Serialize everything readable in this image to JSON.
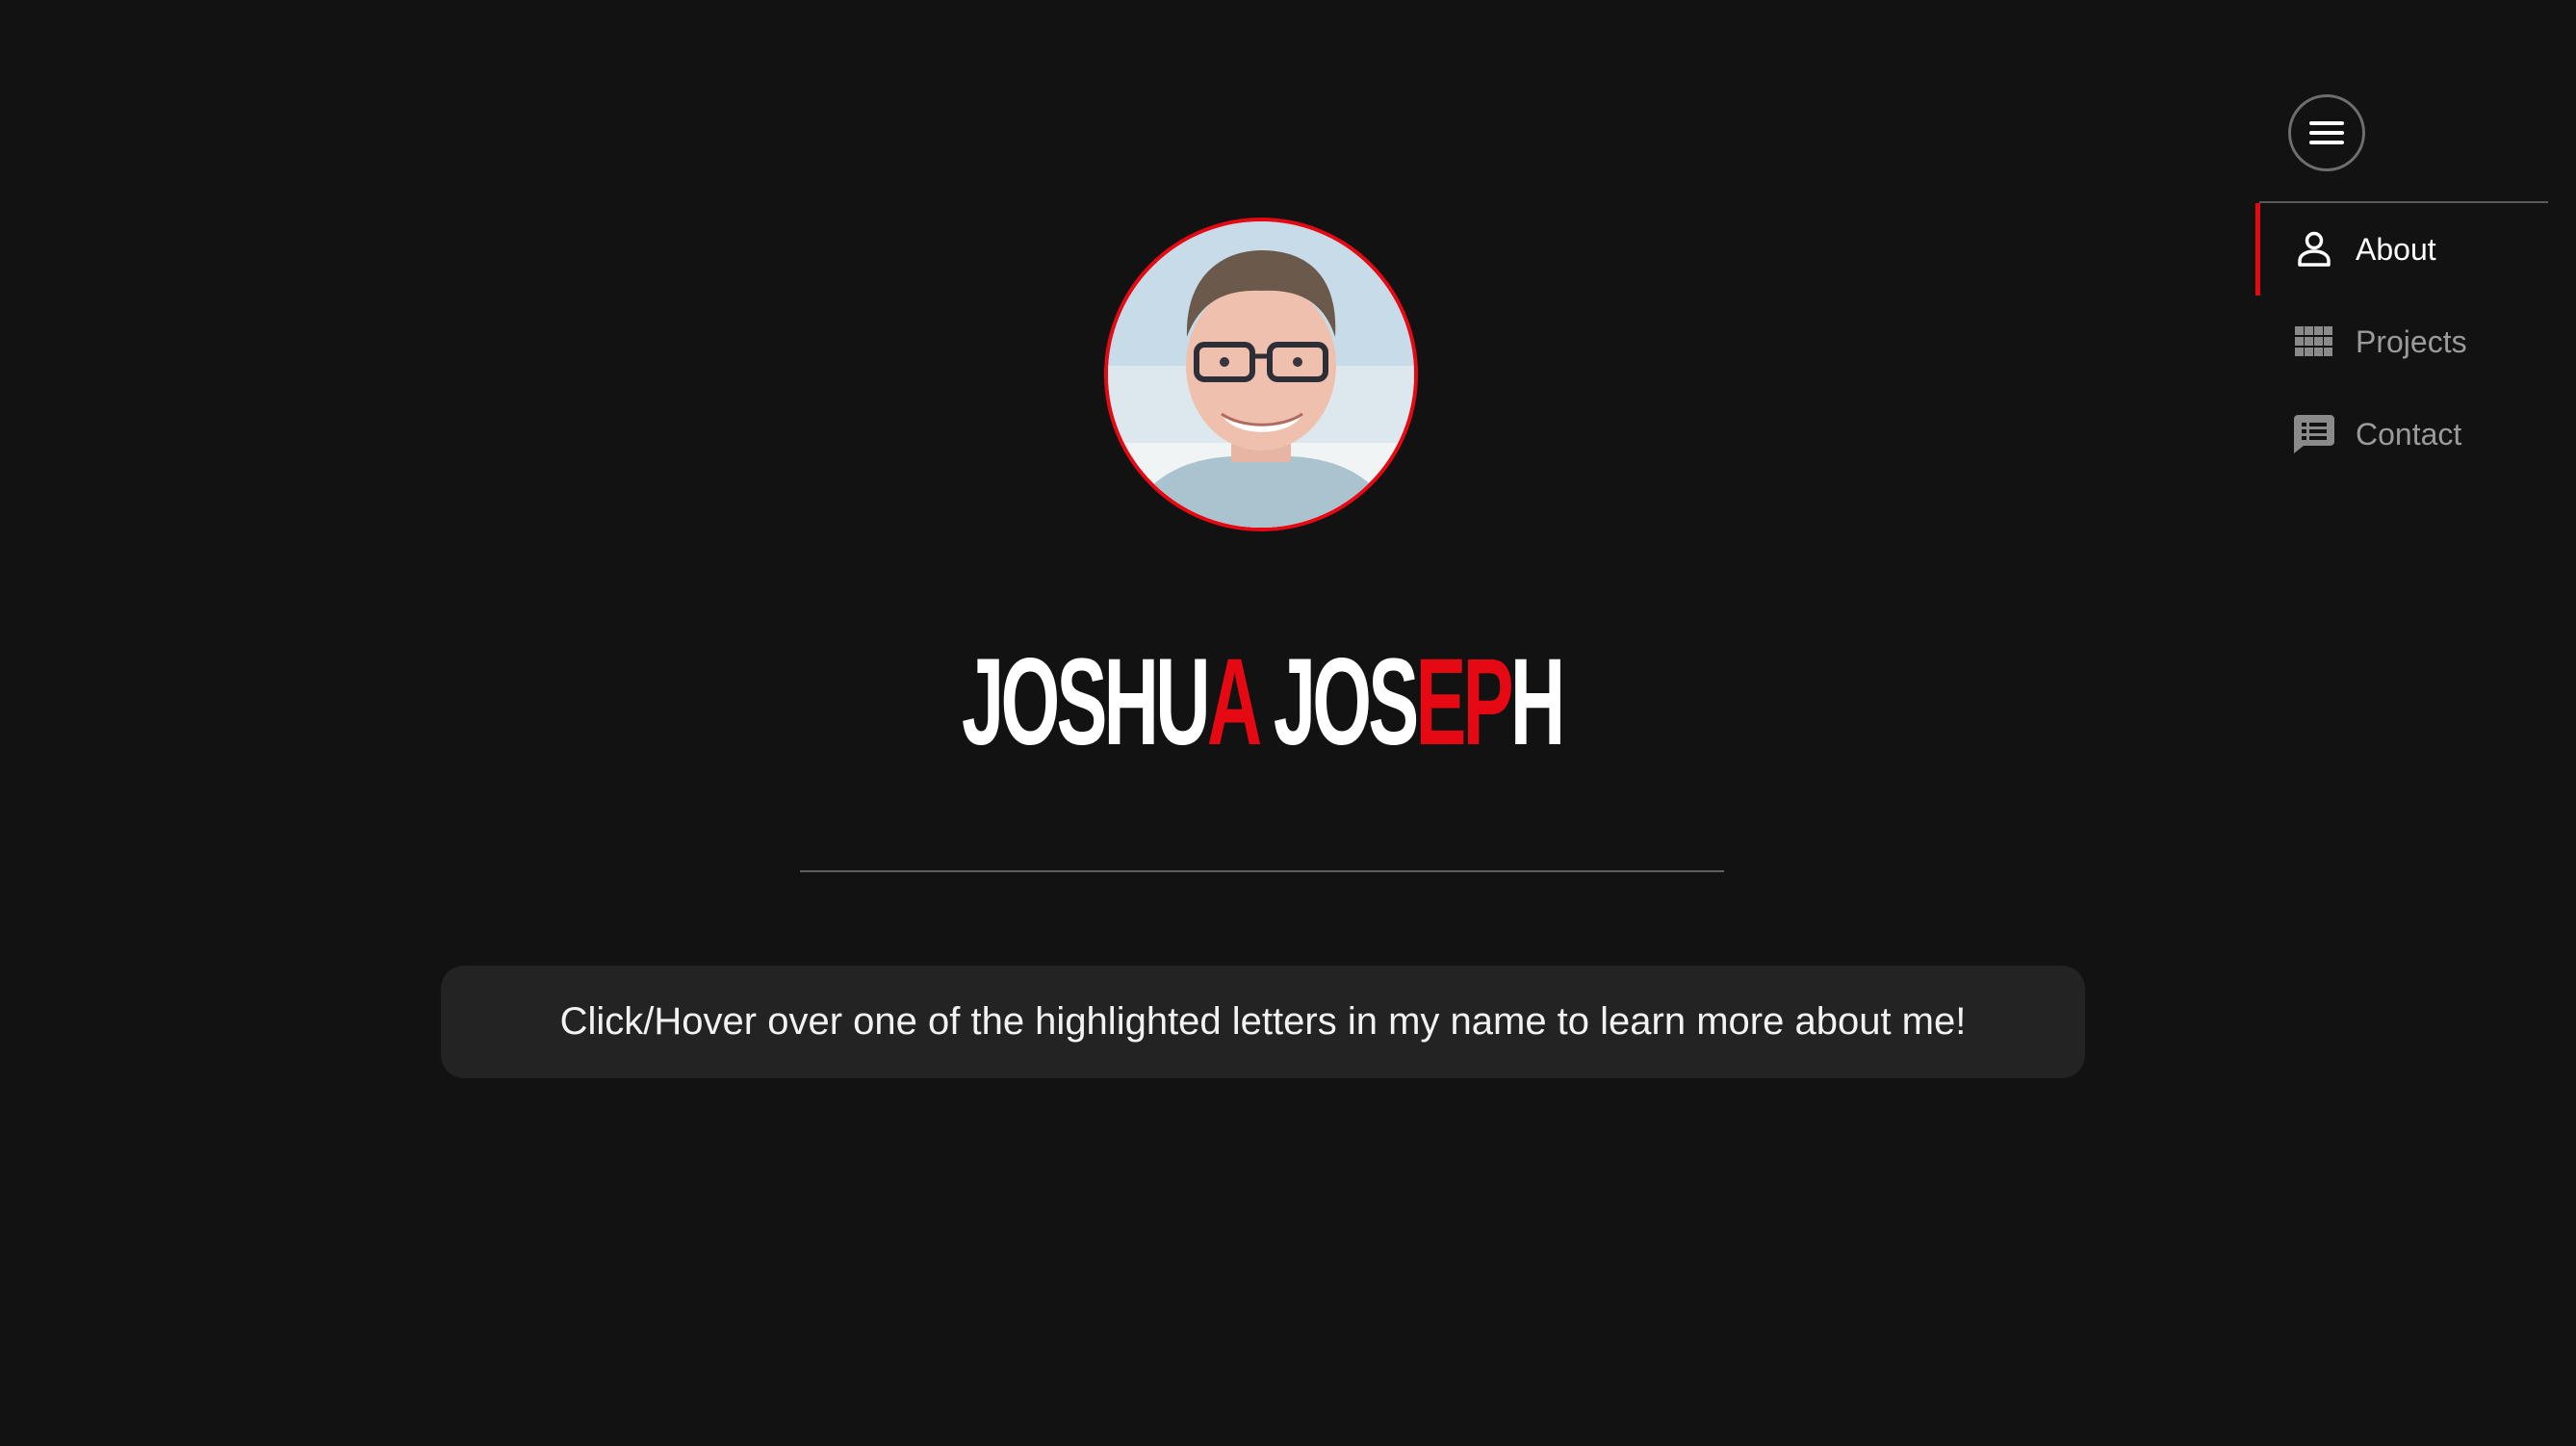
{
  "nav": {
    "menu_icon": "hamburger-menu-icon",
    "items": [
      {
        "label": "About",
        "icon": "person-icon",
        "active": true
      },
      {
        "label": "Projects",
        "icon": "grid-icon",
        "active": false
      },
      {
        "label": "Contact",
        "icon": "message-icon",
        "active": false
      }
    ]
  },
  "profile": {
    "name_parts": [
      {
        "text": "JOSHU",
        "highlight": false
      },
      {
        "text": "A",
        "highlight": true
      },
      {
        "text": " JOS",
        "highlight": false
      },
      {
        "text": "E",
        "highlight": true
      },
      {
        "text": "P",
        "highlight": true
      },
      {
        "text": "H",
        "highlight": false
      }
    ],
    "hint": "Click/Hover over one of the highlighted letters in my name to learn more about me!"
  },
  "colors": {
    "background": "#121212",
    "accent": "#e50914",
    "panel": "#232323"
  }
}
